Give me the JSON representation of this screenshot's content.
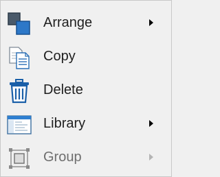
{
  "menu": {
    "items": [
      {
        "label": "Arrange",
        "icon": "arrange-icon",
        "has_submenu": true,
        "enabled": true
      },
      {
        "label": "Copy",
        "icon": "copy-icon",
        "has_submenu": false,
        "enabled": true
      },
      {
        "label": "Delete",
        "icon": "trash-icon",
        "has_submenu": false,
        "enabled": true
      },
      {
        "label": "Library",
        "icon": "library-window-icon",
        "has_submenu": true,
        "enabled": true
      },
      {
        "label": "Group",
        "icon": "group-icon",
        "has_submenu": true,
        "enabled": false
      }
    ]
  },
  "colors": {
    "background": "#f0f0f0",
    "text": "#1f1f1f",
    "disabled_text": "#6e6e6e",
    "icon_blue": "#1c6eb8",
    "icon_dark": "#3a4a5a"
  }
}
